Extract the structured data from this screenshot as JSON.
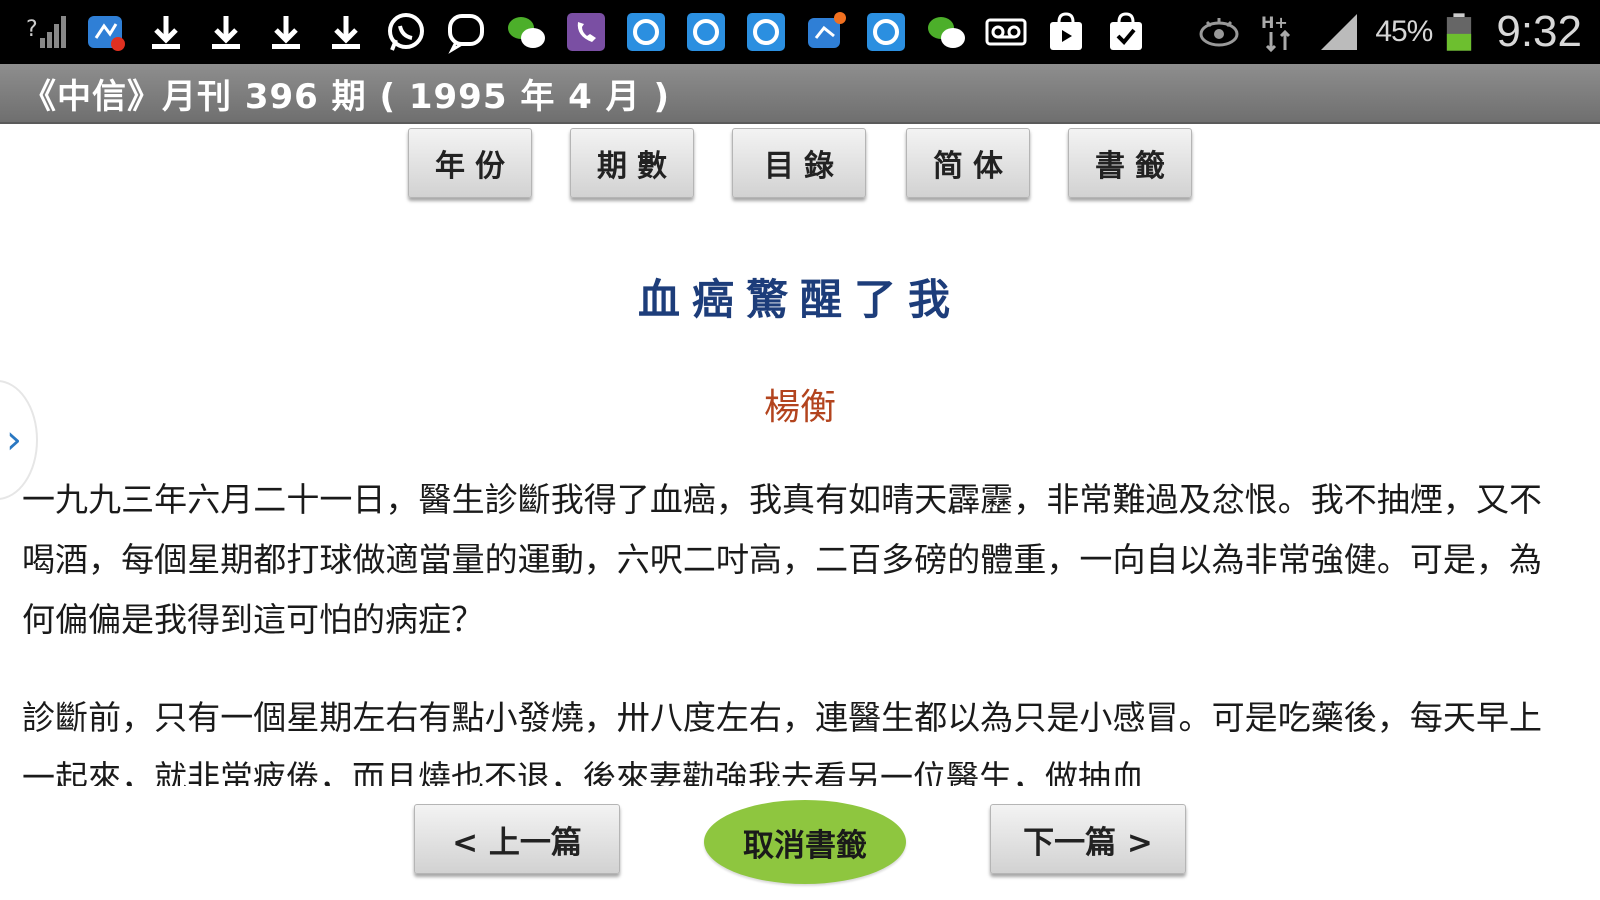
{
  "status_bar": {
    "left_icons": [
      "unknown-signal-icon",
      "notification-app-icon",
      "download-icon",
      "download-icon",
      "download-icon",
      "download-icon",
      "whatsapp-icon",
      "chat-bubble-icon",
      "wechat-icon",
      "viber-icon",
      "app-icon",
      "app-icon",
      "app-icon",
      "notification-app-icon",
      "app-icon",
      "wechat-icon",
      "voicemail-icon",
      "store-bag-icon",
      "task-bag-icon"
    ],
    "battery_percent": "45%",
    "time": "9:32",
    "network_type": "H+"
  },
  "title_bar": {
    "title": "《中信》月刊 396 期 ( 1995 年 4 月 )"
  },
  "toolbar": {
    "buttons": [
      "年份",
      "期數",
      "目錄",
      "简体",
      "書籤"
    ]
  },
  "article": {
    "title": "血癌驚醒了我",
    "author": "楊衡",
    "paragraphs": [
      "一九九三年六月二十一日，醫生診斷我得了血癌，我真有如晴天霹靂，非常難過及忿恨。我不抽煙，又不喝酒，每個星期都打球做適當量的運動，六呎二吋高，二百多磅的體重，一向自以為非常強健。可是，為何偏偏是我得到這可怕的病症？",
      "診斷前，只有一個星期左右有點小發燒，卅八度左右，連醫生都以為只是小感冒。可是吃藥後，每天早上一起來，就非常疲倦，而且燒也不退，後來妻勸強我去看另一位醫生，做抽血"
    ]
  },
  "side_handle": {
    "glyph": "›"
  },
  "bottom_nav": {
    "prev_label": "<  上一篇",
    "bookmark_cancel_label": "取消書籤",
    "next_label": "下一篇  >"
  },
  "colors": {
    "title": "#1d3d7a",
    "author": "#b3441e",
    "bookmark_button": "#8ec63f",
    "battery_fill": "#6dbf2f"
  }
}
